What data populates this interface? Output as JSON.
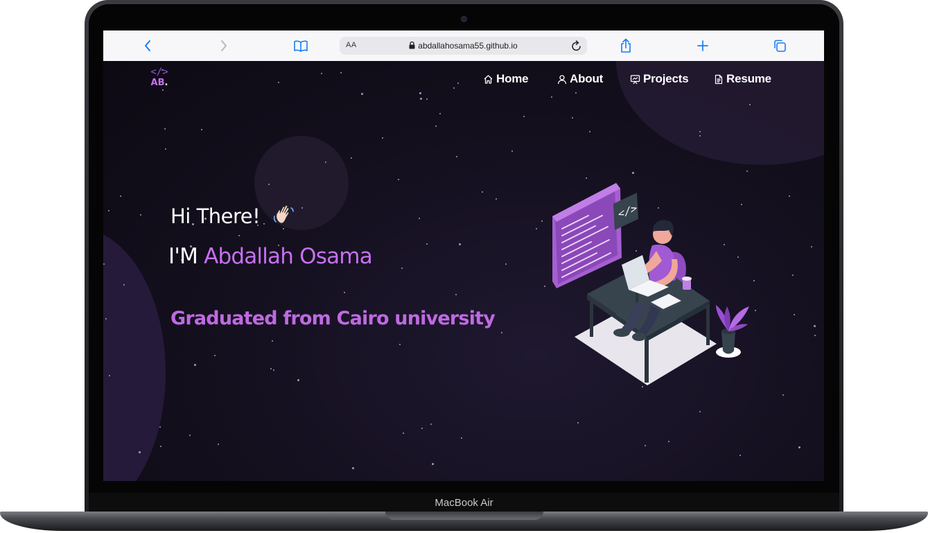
{
  "device": {
    "label": "MacBook Air"
  },
  "browser": {
    "url_domain": "abdallahosama55.github.io",
    "text_size_label": "AA",
    "icons": [
      "back-icon",
      "forward-icon",
      "bookmarks-icon",
      "lock-icon",
      "reload-icon",
      "share-icon",
      "new-tab-icon",
      "tabs-icon"
    ]
  },
  "site": {
    "logo_code": "</>",
    "logo_initials": "AB",
    "logo_dot": ".",
    "nav": [
      {
        "label": "Home",
        "icon": "home-icon"
      },
      {
        "label": "About",
        "icon": "user-icon"
      },
      {
        "label": "Projects",
        "icon": "projects-icon"
      },
      {
        "label": "Resume",
        "icon": "document-icon"
      }
    ]
  },
  "hero": {
    "greeting": "Hi There!",
    "greeting_emoji": "waving-hand-icon",
    "intro_prefix": "I'M ",
    "name": "Abdallah Osama",
    "subtitle": "Graduated from Cairo university",
    "illustration": "developer-at-desk-illustration"
  },
  "colors": {
    "accent": "#c770f0",
    "background": "#0e0b16",
    "toolbar": "#f7f7f9",
    "link_blue": "#1a7cf4"
  }
}
